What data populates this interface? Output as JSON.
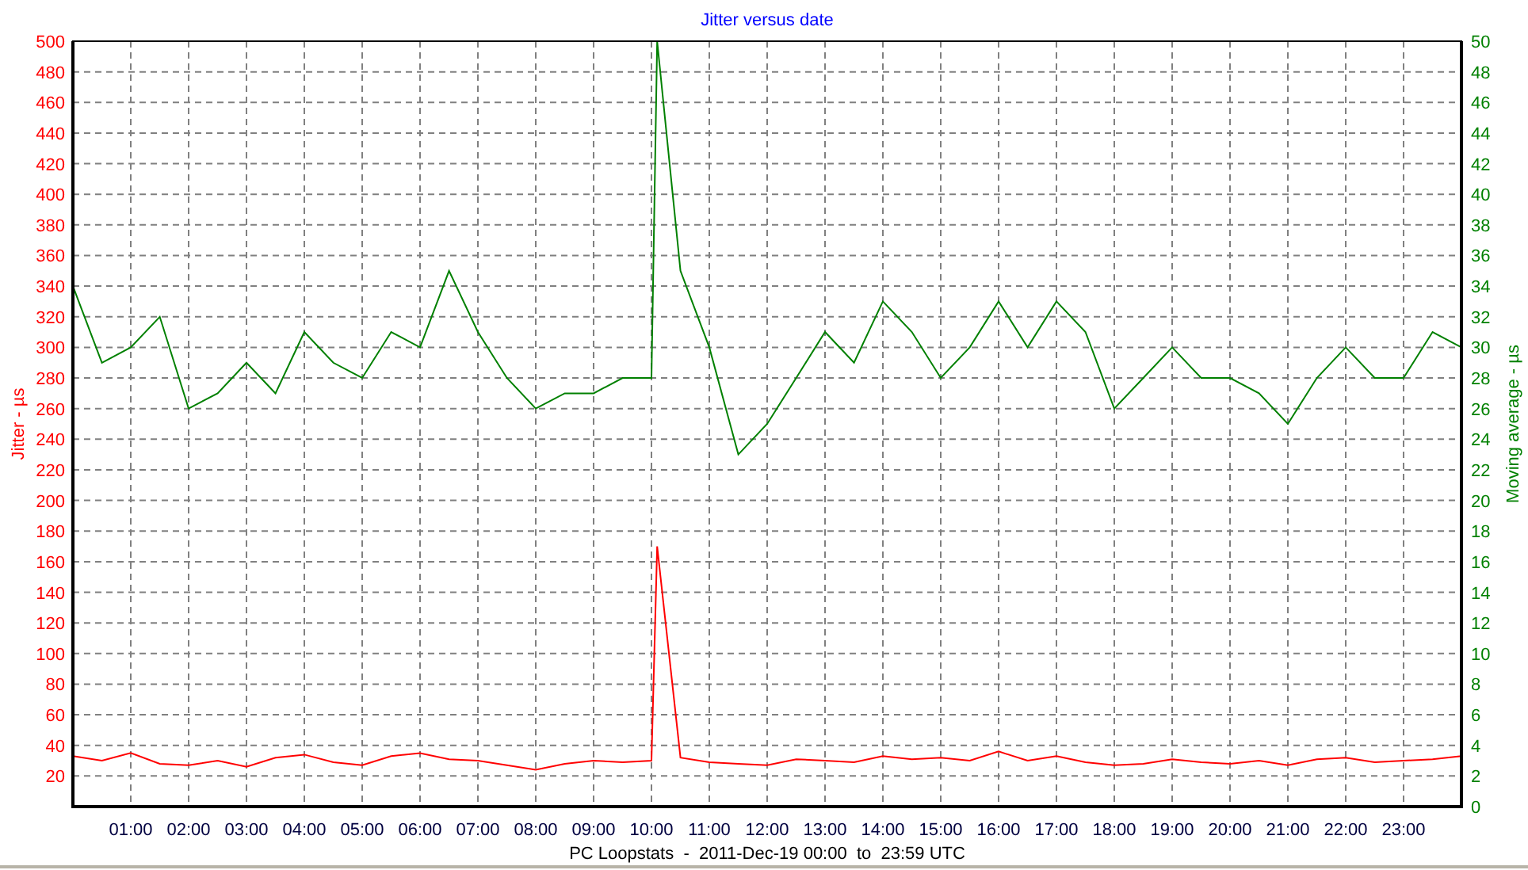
{
  "chart_data": {
    "type": "line",
    "title": "Jitter versus date",
    "xlabel": "PC Loopstats  -  2011-Dec-19 00:00  to  23:59 UTC",
    "ylabel": "Jitter - µs",
    "y2label": "Moving average - µs",
    "x": [
      0,
      0.5,
      1,
      1.5,
      2,
      2.5,
      3,
      3.5,
      4,
      4.5,
      5,
      5.5,
      6,
      6.5,
      7,
      7.5,
      8,
      8.5,
      9,
      9.5,
      10,
      10.1,
      10.5,
      11,
      11.5,
      12,
      12.5,
      13,
      13.5,
      14,
      14.5,
      15,
      15.5,
      16,
      16.5,
      17,
      17.5,
      18,
      18.5,
      19,
      19.5,
      20,
      20.5,
      21,
      21.5,
      22,
      22.5,
      23,
      23.5,
      24
    ],
    "grid": true,
    "xlim": [
      0,
      24
    ],
    "ylim": [
      0,
      500
    ],
    "y2lim": [
      0,
      50
    ],
    "xticks": [
      {
        "value": 1,
        "label": "01:00"
      },
      {
        "value": 2,
        "label": "02:00"
      },
      {
        "value": 3,
        "label": "03:00"
      },
      {
        "value": 4,
        "label": "04:00"
      },
      {
        "value": 5,
        "label": "05:00"
      },
      {
        "value": 6,
        "label": "06:00"
      },
      {
        "value": 7,
        "label": "07:00"
      },
      {
        "value": 8,
        "label": "08:00"
      },
      {
        "value": 9,
        "label": "09:00"
      },
      {
        "value": 10,
        "label": "10:00"
      },
      {
        "value": 11,
        "label": "11:00"
      },
      {
        "value": 12,
        "label": "12:00"
      },
      {
        "value": 13,
        "label": "13:00"
      },
      {
        "value": 14,
        "label": "14:00"
      },
      {
        "value": 15,
        "label": "15:00"
      },
      {
        "value": 16,
        "label": "16:00"
      },
      {
        "value": 17,
        "label": "17:00"
      },
      {
        "value": 18,
        "label": "18:00"
      },
      {
        "value": 19,
        "label": "19:00"
      },
      {
        "value": 20,
        "label": "20:00"
      },
      {
        "value": 21,
        "label": "21:00"
      },
      {
        "value": 22,
        "label": "22:00"
      },
      {
        "value": 23,
        "label": "23:00"
      }
    ],
    "yticks": [
      20,
      40,
      60,
      80,
      100,
      120,
      140,
      160,
      180,
      200,
      220,
      240,
      260,
      280,
      300,
      320,
      340,
      360,
      380,
      400,
      420,
      440,
      460,
      480,
      500
    ],
    "y2ticks": [
      0,
      2,
      4,
      6,
      8,
      10,
      12,
      14,
      16,
      18,
      20,
      22,
      24,
      26,
      28,
      30,
      32,
      34,
      36,
      38,
      40,
      42,
      44,
      46,
      48,
      50
    ],
    "series": [
      {
        "color": "#ff0000",
        "values": [
          33,
          30,
          35,
          28,
          27,
          30,
          26,
          32,
          34,
          29,
          27,
          33,
          35,
          31,
          30,
          27,
          24,
          28,
          30,
          29,
          30,
          170,
          32,
          29,
          28,
          27,
          31,
          30,
          29,
          33,
          31,
          32,
          30,
          36,
          30,
          33,
          29,
          27,
          28,
          31,
          29,
          28,
          30,
          27,
          31,
          32,
          29,
          30,
          31,
          33
        ]
      },
      {
        "color": "#008000",
        "axis": "y2",
        "values": [
          34,
          29,
          30,
          32,
          26,
          27,
          29,
          27,
          31,
          29,
          28,
          31,
          30,
          35,
          31,
          28,
          26,
          27,
          27,
          28,
          28,
          50,
          35,
          30,
          23,
          25,
          28,
          31,
          29,
          33,
          31,
          28,
          30,
          33,
          30,
          33,
          31,
          26,
          28,
          30,
          28,
          28,
          27,
          25,
          28,
          30,
          28,
          28,
          31,
          30
        ]
      }
    ]
  }
}
